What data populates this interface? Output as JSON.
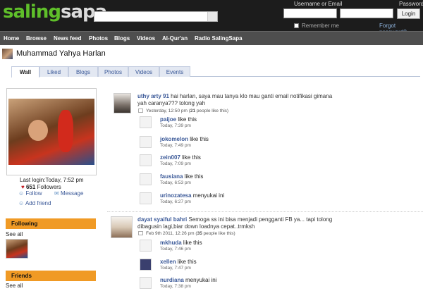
{
  "brand": {
    "part1": "saling",
    "part2": "sapa",
    "accent": "#5fbf2a",
    "header_bg": "#1c1c1c",
    "nav_bg": "#4e4e4e",
    "orange": "#f09a25"
  },
  "login": {
    "user_label": "Username or Email",
    "pass_label": "Password",
    "button": "Login",
    "remember": "Remember me",
    "forgot": "Forgot password?"
  },
  "nav": [
    "Home",
    "Browse",
    "News feed",
    "Photos",
    "Blogs",
    "Videos",
    "Al-Qur'an",
    "Radio SalingSapa"
  ],
  "profile": {
    "name": "Muhammad Yahya Harlan",
    "last_login": "Last login:Today, 7:52 pm",
    "followers_count": "651",
    "followers_label": "Followers",
    "follow": "Follow",
    "message": "Message",
    "add_friend": "Add friend"
  },
  "tabs": [
    "Wall",
    "Liked",
    "Blogs",
    "Photos",
    "Videos",
    "Events"
  ],
  "sidebar": {
    "following": "Following",
    "see_all": "See all",
    "friends": "Friends",
    "see_all2": "See all"
  },
  "posts": [
    {
      "user": "uthy arty 91",
      "text": "hai harlan, saya mau tanya klo mau ganti email notifikasi gimana yah caranya??? tolong yah",
      "meta_time": "Yesterday, 12:50 pm (",
      "meta_count": "21",
      "meta_tail": " people like this)",
      "likes": [
        {
          "user": "paijoe",
          "action": "like this",
          "time": "Today, 7:39 pm"
        },
        {
          "user": "jokomelon",
          "action": "like this",
          "time": "Today, 7:49 pm"
        },
        {
          "user": "zein007",
          "action": "like this",
          "time": "Today, 7:09 pm"
        },
        {
          "user": "fausiana",
          "action": "like this",
          "time": "Today, 6:53 pm"
        },
        {
          "user": "urinozatesa",
          "action": "menyukai ini",
          "time": "Today, 6:27 pm"
        }
      ]
    },
    {
      "user": "dayat syaiful bahri",
      "text": "Semoga ss ini bisa menjadi pengganti FB ya... tapi tolong dibagusin lagi,biar down loadnya cepat..trmksh",
      "meta_time": "Feb 9th 2011, 12:26 pm (",
      "meta_count": "35",
      "meta_tail": " people like this)",
      "likes": [
        {
          "user": "mkhuda",
          "action": "like this",
          "time": "Today, 7:46 pm"
        },
        {
          "user": "xellen",
          "action": "like this",
          "time": "Today, 7:47 pm"
        },
        {
          "user": "nurdiana",
          "action": "menyukai ini",
          "time": "Today, 7:38 pm"
        }
      ]
    }
  ]
}
